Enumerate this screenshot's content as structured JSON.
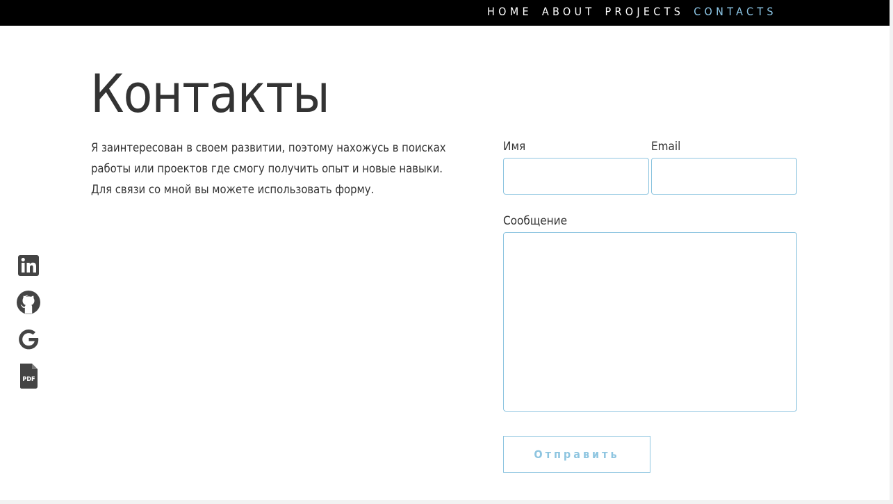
{
  "nav": {
    "items": [
      {
        "label": "HOME"
      },
      {
        "label": "ABOUT"
      },
      {
        "label": "PROJECTS"
      },
      {
        "label": "CONTACTS"
      }
    ],
    "active_color": "#8ec8e8"
  },
  "page": {
    "title": "Контакты",
    "intro": "Я заинтересован в своем развитии, поэтому нахожусь в поисках работы или проектов где смогу получить опыт и новые навыки. Для связи со мной вы можете использовать форму."
  },
  "form": {
    "name_label": "Имя",
    "name_value": "",
    "email_label": "Email",
    "email_value": "",
    "message_label": "Сообщение",
    "message_value": "",
    "submit_label": "Отправить",
    "accent_color": "#8ec5e0"
  },
  "social": {
    "icons": [
      "linkedin-icon",
      "github-icon",
      "google-icon",
      "pdf-icon"
    ],
    "pdf_text": "PDF",
    "icon_color": "#444444"
  }
}
